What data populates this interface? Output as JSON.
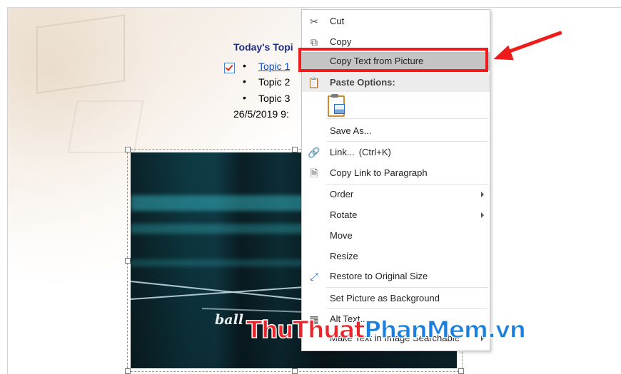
{
  "document": {
    "heading": "Today's Topi",
    "topics": [
      {
        "label": "Topic 1",
        "checked": true,
        "is_link": true
      },
      {
        "label": "Topic 2",
        "checked": false,
        "is_link": false
      },
      {
        "label": "Topic 3",
        "checked": false,
        "is_link": false
      }
    ],
    "date_text": "26/5/2019 9:",
    "picture_caption": "ball"
  },
  "context_menu": {
    "items": {
      "cut": {
        "label": "Cut",
        "icon": "scissors-icon"
      },
      "copy": {
        "label": "Copy",
        "icon": "copy-icon"
      },
      "copy_text_from_picture": {
        "label": "Copy Text from Picture",
        "highlighted": true
      },
      "paste_options_header": {
        "label": "Paste Options:",
        "icon": "paste-icon"
      },
      "paste_picture": {
        "icon": "paste-picture-icon"
      },
      "save_as": {
        "label": "Save As..."
      },
      "link": {
        "label": "Link...",
        "shortcut": "(Ctrl+K)",
        "icon": "link-icon"
      },
      "copy_link_to_paragraph": {
        "label": "Copy Link to Paragraph",
        "icon": "document-link-icon"
      },
      "order": {
        "label": "Order",
        "has_submenu": true
      },
      "rotate": {
        "label": "Rotate",
        "has_submenu": true
      },
      "move": {
        "label": "Move"
      },
      "resize": {
        "label": "Resize"
      },
      "restore_original_size": {
        "label": "Restore to Original Size",
        "icon": "restore-size-icon"
      },
      "set_picture_background": {
        "label": "Set Picture as Background"
      },
      "alt_text": {
        "label": "Alt Text...",
        "icon": "alt-text-icon"
      },
      "make_text_searchable": {
        "label": "Make Text in Image Searchable"
      }
    }
  },
  "annotation": {
    "color": "#ee1c1c",
    "watermark_part1": "ThuThuat",
    "watermark_part2": "PhanMem.vn"
  }
}
